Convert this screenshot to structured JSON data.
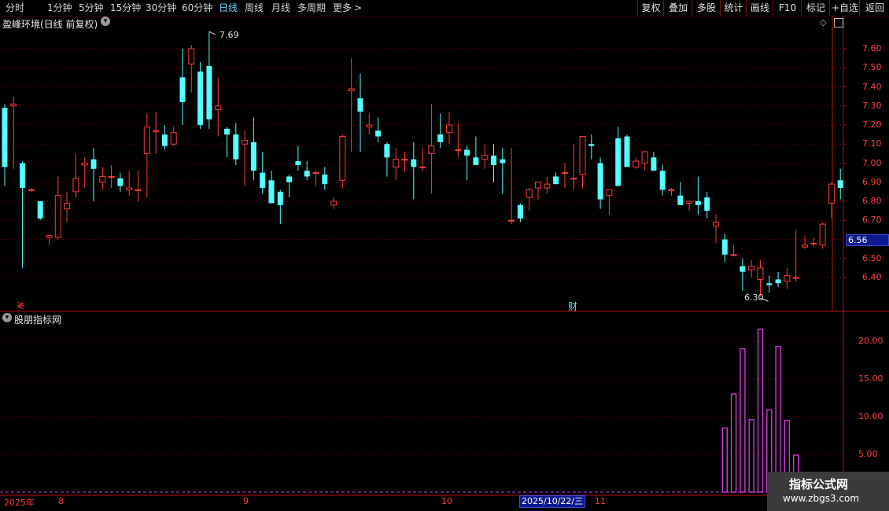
{
  "toolbar": {
    "periods": [
      "分时",
      "1分钟",
      "5分钟",
      "15分钟",
      "30分钟",
      "60分钟",
      "日线",
      "周线",
      "月线",
      "多周期",
      "更多"
    ],
    "active_period": "日线",
    "right_buttons": [
      "复权",
      "叠加",
      "多股",
      "统计",
      "画线",
      "F10",
      "+自选",
      "返回"
    ],
    "more_arrow": ">",
    "mark": "标记"
  },
  "main_panel": {
    "title": "盈峰环境(日线 前复权)",
    "current_price_label": "6.56",
    "high_marker": "7.69",
    "low_marker": "6.30",
    "event_marker": "财",
    "left_marker": "≷",
    "y_ticks": [
      "7.60",
      "7.50",
      "7.40",
      "7.30",
      "7.20",
      "7.10",
      "7.00",
      "6.90",
      "6.80",
      "6.70",
      "6.50",
      "6.40"
    ]
  },
  "sub_panel": {
    "title": "股朋指标网",
    "y_ticks": [
      "20.00",
      "15.00",
      "10.00",
      "5.00"
    ]
  },
  "date_axis": {
    "labels": [
      "2025年",
      "8",
      "9",
      "10",
      "11"
    ],
    "cursor_date": "2025/10/22/三"
  },
  "watermark": {
    "line1": "指标公式网",
    "line2": "www.zbgs3.com"
  },
  "colors": {
    "up": "#ff3b3b",
    "down": "#54ffff",
    "grid": "#7a0000",
    "indicator": "#d13bd8",
    "price_box": "#0c1a8c"
  },
  "chart_data": {
    "type": "candlestick",
    "price_range": [
      6.21,
      7.75
    ],
    "candles": [
      [
        7.29,
        7.31,
        6.88,
        6.98
      ],
      [
        7.3,
        7.35,
        6.97,
        7.31
      ],
      [
        7.0,
        7.01,
        6.45,
        6.87
      ],
      [
        6.86,
        6.87,
        6.85,
        6.86
      ],
      [
        6.8,
        6.8,
        6.7,
        6.71
      ],
      [
        6.61,
        6.61,
        6.57,
        6.62
      ],
      [
        6.61,
        6.93,
        6.6,
        6.83
      ],
      [
        6.76,
        6.85,
        6.69,
        6.79
      ],
      [
        6.85,
        7.05,
        6.82,
        6.92
      ],
      [
        6.99,
        7.03,
        6.87,
        7.0
      ],
      [
        7.02,
        7.08,
        6.8,
        6.97
      ],
      [
        6.9,
        6.98,
        6.86,
        6.93
      ],
      [
        6.93,
        6.99,
        6.87,
        6.93
      ],
      [
        6.92,
        6.95,
        6.85,
        6.88
      ],
      [
        6.86,
        6.96,
        6.83,
        6.87
      ],
      [
        6.86,
        6.96,
        6.8,
        6.86
      ],
      [
        7.05,
        7.26,
        6.82,
        7.19
      ],
      [
        7.17,
        7.27,
        7.05,
        7.17
      ],
      [
        7.15,
        7.2,
        7.07,
        7.09
      ],
      [
        7.1,
        7.19,
        7.09,
        7.16
      ],
      [
        7.45,
        7.6,
        7.2,
        7.32
      ],
      [
        7.52,
        7.62,
        7.37,
        7.6
      ],
      [
        7.48,
        7.53,
        7.18,
        7.2
      ],
      [
        7.51,
        7.69,
        7.18,
        7.23
      ],
      [
        7.28,
        7.45,
        7.14,
        7.3
      ],
      [
        7.18,
        7.19,
        7.03,
        7.15
      ],
      [
        7.15,
        7.21,
        6.99,
        7.02
      ],
      [
        7.1,
        7.17,
        6.88,
        7.12
      ],
      [
        7.11,
        7.24,
        6.91,
        6.96
      ],
      [
        6.95,
        7.06,
        6.84,
        6.87
      ],
      [
        6.91,
        6.96,
        6.79,
        6.79
      ],
      [
        6.85,
        6.86,
        6.68,
        6.78
      ],
      [
        6.93,
        6.94,
        6.82,
        6.9
      ],
      [
        7.01,
        7.09,
        6.96,
        6.99
      ],
      [
        6.96,
        7.01,
        6.91,
        6.93
      ],
      [
        6.95,
        6.96,
        6.88,
        6.95
      ],
      [
        6.94,
        6.98,
        6.86,
        6.89
      ],
      [
        6.78,
        6.82,
        6.76,
        6.8
      ],
      [
        6.91,
        7.15,
        6.87,
        7.14
      ],
      [
        7.38,
        7.55,
        7.06,
        7.39
      ],
      [
        7.34,
        7.47,
        7.06,
        7.27
      ],
      [
        7.19,
        7.26,
        7.15,
        7.2
      ],
      [
        7.17,
        7.24,
        7.11,
        7.14
      ],
      [
        7.1,
        7.11,
        6.93,
        7.03
      ],
      [
        6.98,
        7.08,
        6.91,
        7.02
      ],
      [
        7.02,
        7.06,
        6.95,
        7.02
      ],
      [
        7.02,
        7.11,
        6.81,
        6.98
      ],
      [
        6.98,
        7.08,
        6.96,
        6.98
      ],
      [
        7.05,
        7.31,
        6.84,
        7.09
      ],
      [
        7.15,
        7.26,
        7.08,
        7.11
      ],
      [
        7.16,
        7.27,
        7.1,
        7.2
      ],
      [
        7.07,
        7.21,
        7.03,
        7.07
      ],
      [
        7.07,
        7.09,
        6.91,
        7.04
      ],
      [
        7.03,
        7.14,
        7.0,
        6.99
      ],
      [
        7.02,
        7.1,
        6.97,
        7.04
      ],
      [
        7.04,
        7.1,
        6.9,
        6.99
      ],
      [
        7.02,
        7.08,
        6.84,
        7.0
      ],
      [
        6.7,
        7.08,
        6.68,
        6.7
      ],
      [
        6.78,
        6.79,
        6.69,
        6.71
      ],
      [
        6.82,
        6.87,
        6.75,
        6.86
      ],
      [
        6.87,
        6.9,
        6.81,
        6.9
      ],
      [
        6.87,
        6.93,
        6.84,
        6.89
      ],
      [
        6.93,
        6.95,
        6.89,
        6.89
      ],
      [
        6.95,
        7.0,
        6.87,
        6.95
      ],
      [
        6.92,
        7.1,
        6.86,
        6.92
      ],
      [
        6.94,
        7.11,
        6.87,
        7.14
      ],
      [
        7.1,
        7.15,
        7.02,
        7.09
      ],
      [
        7.0,
        7.03,
        6.76,
        6.81
      ],
      [
        6.83,
        6.85,
        6.73,
        6.86
      ],
      [
        7.13,
        7.19,
        7.09,
        6.88
      ],
      [
        7.14,
        7.15,
        6.98,
        6.98
      ],
      [
        6.98,
        7.03,
        6.97,
        7.01
      ],
      [
        7.0,
        7.06,
        6.96,
        7.06
      ],
      [
        7.03,
        7.06,
        6.97,
        6.96
      ],
      [
        6.96,
        6.99,
        6.83,
        6.86
      ],
      [
        6.86,
        6.87,
        6.83,
        6.86
      ],
      [
        6.83,
        6.9,
        6.78,
        6.78
      ],
      [
        6.79,
        6.8,
        6.75,
        6.8
      ],
      [
        6.8,
        6.93,
        6.73,
        6.78
      ],
      [
        6.82,
        6.85,
        6.71,
        6.75
      ],
      [
        6.67,
        6.73,
        6.58,
        6.69
      ],
      [
        6.6,
        6.63,
        6.48,
        6.52
      ],
      [
        6.52,
        6.57,
        6.51,
        6.52
      ],
      [
        6.46,
        6.5,
        6.33,
        6.43
      ],
      [
        6.44,
        6.49,
        6.4,
        6.46
      ],
      [
        6.39,
        6.49,
        6.3,
        6.45
      ],
      [
        6.37,
        6.41,
        6.32,
        6.36
      ],
      [
        6.39,
        6.43,
        6.35,
        6.37
      ],
      [
        6.38,
        6.45,
        6.34,
        6.41
      ],
      [
        6.4,
        6.65,
        6.38,
        6.4
      ],
      [
        6.56,
        6.62,
        6.55,
        6.57
      ],
      [
        6.58,
        6.61,
        6.56,
        6.58
      ],
      [
        6.57,
        6.69,
        6.55,
        6.68
      ],
      [
        6.79,
        6.9,
        6.71,
        6.89
      ],
      [
        6.91,
        6.97,
        6.81,
        6.87
      ]
    ],
    "indicator": {
      "type": "bar",
      "range": [
        0,
        22.5
      ],
      "start_index": 81,
      "values": [
        8.5,
        13.0,
        19.0,
        9.6,
        21.6,
        10.9,
        19.3,
        9.5,
        4.9,
        2.6,
        0.4
      ]
    }
  }
}
